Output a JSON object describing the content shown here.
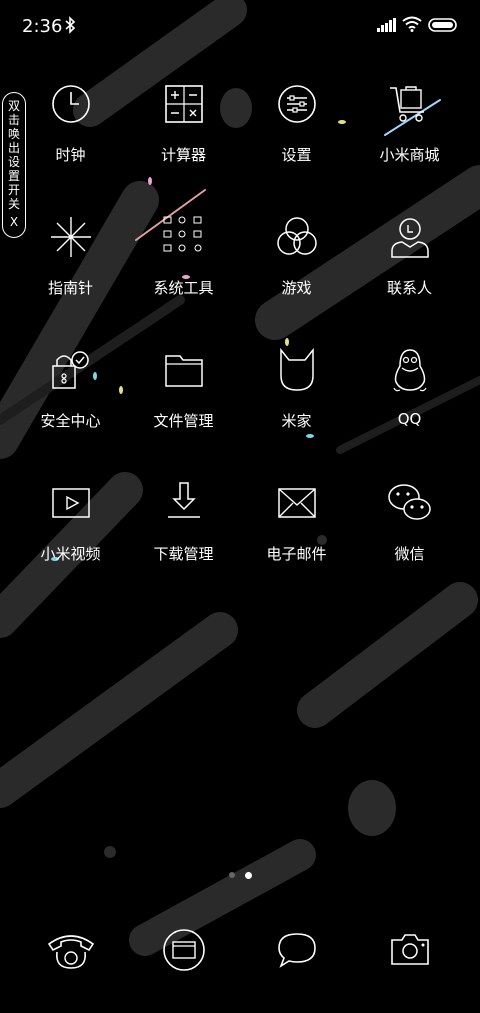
{
  "status_bar": {
    "time": "2:36"
  },
  "side_tab": {
    "chars": [
      "双",
      "击",
      "唤",
      "出",
      "设",
      "置",
      "开",
      "关"
    ],
    "close": "X"
  },
  "apps": [
    [
      {
        "label": "时钟",
        "icon": "clock-icon"
      },
      {
        "label": "计算器",
        "icon": "calculator-icon"
      },
      {
        "label": "设置",
        "icon": "settings-icon"
      },
      {
        "label": "小米商城",
        "icon": "shopping-cart-icon"
      }
    ],
    [
      {
        "label": "指南针",
        "icon": "compass-icon"
      },
      {
        "label": "系统工具",
        "icon": "tools-folder-icon"
      },
      {
        "label": "游戏",
        "icon": "games-icon"
      },
      {
        "label": "联系人",
        "icon": "contacts-icon"
      }
    ],
    [
      {
        "label": "安全中心",
        "icon": "security-icon"
      },
      {
        "label": "文件管理",
        "icon": "folder-icon"
      },
      {
        "label": "米家",
        "icon": "mijia-icon"
      },
      {
        "label": "QQ",
        "icon": "qq-penguin-icon"
      }
    ],
    [
      {
        "label": "小米视频",
        "icon": "video-icon"
      },
      {
        "label": "下载管理",
        "icon": "download-icon"
      },
      {
        "label": "电子邮件",
        "icon": "mail-icon"
      },
      {
        "label": "微信",
        "icon": "wechat-icon"
      }
    ]
  ],
  "pager": {
    "pages": 2,
    "current": 2
  },
  "dock": [
    {
      "icon": "phone-icon"
    },
    {
      "icon": "browser-icon"
    },
    {
      "icon": "messages-icon"
    },
    {
      "icon": "camera-icon"
    }
  ]
}
